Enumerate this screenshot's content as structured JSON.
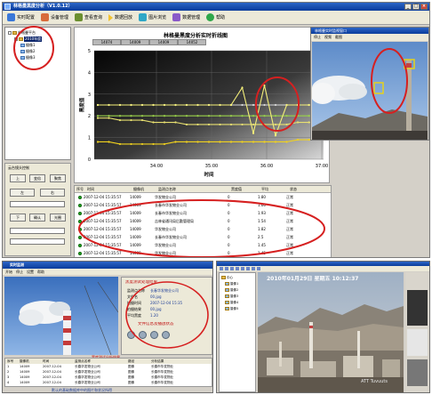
{
  "main_window": {
    "title": "林格曼黑度分析（V1.0.12）",
    "toolbar": [
      "实时配置",
      "设备管理",
      "查看查询",
      "数据回放",
      "图片浏览",
      "数据管理",
      "帮助"
    ],
    "tree": {
      "root": "林格曼平台",
      "selected": "2010年度",
      "children": [
        "摄像1",
        "摄像2",
        "摄像3"
      ]
    },
    "controls": {
      "group": "云台镜头控制",
      "row1": [
        "上",
        "变倍",
        "聚焦"
      ],
      "row2": [
        "左",
        "右"
      ],
      "row3": [
        "下",
        "确认",
        "光圈"
      ]
    }
  },
  "chart_data": {
    "type": "line",
    "title": "林格曼黑度分析实时折线图",
    "xlabel": "时间",
    "ylabel": "黑度值",
    "x_ticks": [
      "34:00",
      "35:00",
      "36:00",
      "37:00"
    ],
    "y_ticks": [
      "0",
      "1",
      "2",
      "3",
      "4",
      "5"
    ],
    "ylim": [
      0,
      5
    ],
    "header_tabs": [
      "14074",
      "14009",
      "14009",
      "14052"
    ],
    "grid": true,
    "series": [
      {
        "values": [
          2.5,
          2.5,
          2.5,
          2.5,
          2.5,
          2.5,
          2.5,
          2.5,
          2.5,
          2.5,
          2.5,
          2.5,
          2.5,
          2.5,
          2.5,
          2.5,
          2.5,
          2.5,
          2.5,
          2.5,
          2.5
        ],
        "color": "#d8d8d8"
      },
      {
        "values": [
          2.0,
          2.0,
          2.0,
          2.0,
          2.0,
          2.0,
          2.0,
          2.0,
          2.0,
          2.0,
          2.0,
          2.0,
          2.0,
          2.0,
          2.0,
          2.0,
          2.0,
          2.0,
          2.0,
          2.0,
          2.0
        ],
        "color": "#9ad14a"
      },
      {
        "values": [
          1.9,
          1.9,
          1.8,
          1.8,
          1.8,
          1.7,
          1.7,
          1.7,
          1.6,
          1.6,
          1.6,
          1.6,
          1.6,
          1.6,
          1.6,
          1.6,
          1.6,
          1.6,
          1.7,
          1.7,
          1.7
        ],
        "color": "#e8e070"
      },
      {
        "values": [
          0.8,
          0.8,
          0.7,
          0.7,
          0.7,
          0.7,
          0.7,
          0.8,
          0.8,
          0.8,
          0.8,
          0.8,
          0.8,
          0.8,
          0.8,
          0.8,
          0.8,
          0.8,
          0.9,
          0.9,
          0.9
        ],
        "color": "#f1d21e"
      },
      {
        "values": [
          2.5,
          2.5,
          2.5,
          2.5,
          2.5,
          2.5,
          2.5,
          2.5,
          2.5,
          2.5,
          2.5,
          2.5,
          2.5,
          3.3,
          1.2,
          3.4,
          1.1,
          2.5,
          2.5,
          2.5,
          2.5
        ],
        "color": "#f5f07a"
      }
    ]
  },
  "camera_panel": {
    "title": "林格曼实时监视窗口",
    "toolbar": [
      "停止",
      "视频",
      "截图"
    ]
  },
  "records": {
    "headers": [
      "序号",
      "时间",
      "摄像机",
      "监测点名称",
      "黑度值",
      "平均",
      "状态"
    ],
    "rows": [
      [
        "1",
        "2007-12-04 15:35:57",
        "14009",
        "华发物业公司",
        "0",
        "1.80",
        "正常"
      ],
      [
        "2",
        "2007-12-04 15:35:57",
        "14009",
        "长春市华发物业公司",
        "0",
        "1.60",
        "正常"
      ],
      [
        "3",
        "2007-12-04 15:35:57",
        "14009",
        "长春市华发物业公司",
        "0",
        "1.93",
        "正常"
      ],
      [
        "4",
        "2007-12-04 15:35:57",
        "14009",
        "吉林省通讯局后勤管理局",
        "0",
        "1.54",
        "正常"
      ],
      [
        "5",
        "2007-12-04 15:35:57",
        "14009",
        "华发物业公司",
        "0",
        "1.82",
        "正常"
      ],
      [
        "6",
        "2007-12-04 15:35:57",
        "14009",
        "长春市华发物业公司",
        "0",
        "2.5",
        "正常"
      ],
      [
        "7",
        "2007-12-04 15:35:57",
        "14009",
        "华发物业公司",
        "0",
        "1.45",
        "正常"
      ],
      [
        "8",
        "2007-12-04 15:35:57",
        "14009",
        "华发物业公司",
        "0",
        "1.45",
        "正常"
      ]
    ]
  },
  "bottom_left": {
    "title": "实时监测",
    "toolbar": [
      "开始",
      "停止",
      "设置",
      "帮助"
    ],
    "info_title": "黑度测试处理结果",
    "info_rows": [
      [
        "监测点名称",
        "长春华发物业公司"
      ],
      [
        "文件名",
        "00.jpg"
      ],
      [
        "拍摄时间",
        "2007-12-04 15:35"
      ],
      [
        "拍摄结果",
        "00.jpg"
      ],
      [
        "平均黑度",
        "1.20"
      ]
    ],
    "info_note": "文件信息及播放状态",
    "status_caption": "黑度测试分析结果",
    "table_headers": [
      "序号",
      "摄像机",
      "时间",
      "监测点名称",
      "路径",
      "分析结果"
    ],
    "table_rows": [
      [
        "1",
        "14009",
        "2007-12-04",
        "长春华发物业公司",
        "图像",
        "长春市华发物业"
      ],
      [
        "2",
        "14009",
        "2007-12-04",
        "长春华发物业公司",
        "图像",
        "长春市华发物业"
      ],
      [
        "3",
        "14009",
        "2007-12-04",
        "长春华发物业公司",
        "图像",
        "长春市华发物业"
      ],
      [
        "4",
        "14009",
        "2007-12-04",
        "长春华发物业公司",
        "图像",
        "长春市华发物业"
      ]
    ],
    "footer_note": "默认的基础数据库中的图片和状况所得"
  },
  "bottom_right": {
    "tree": [
      "中心",
      "摄像1",
      "摄像2",
      "摄像3",
      "摄像4",
      "摄像5"
    ],
    "timestamp": "2010年01月29日  星期五  10:12:37",
    "watermark": "ATT Tuvuuts"
  }
}
